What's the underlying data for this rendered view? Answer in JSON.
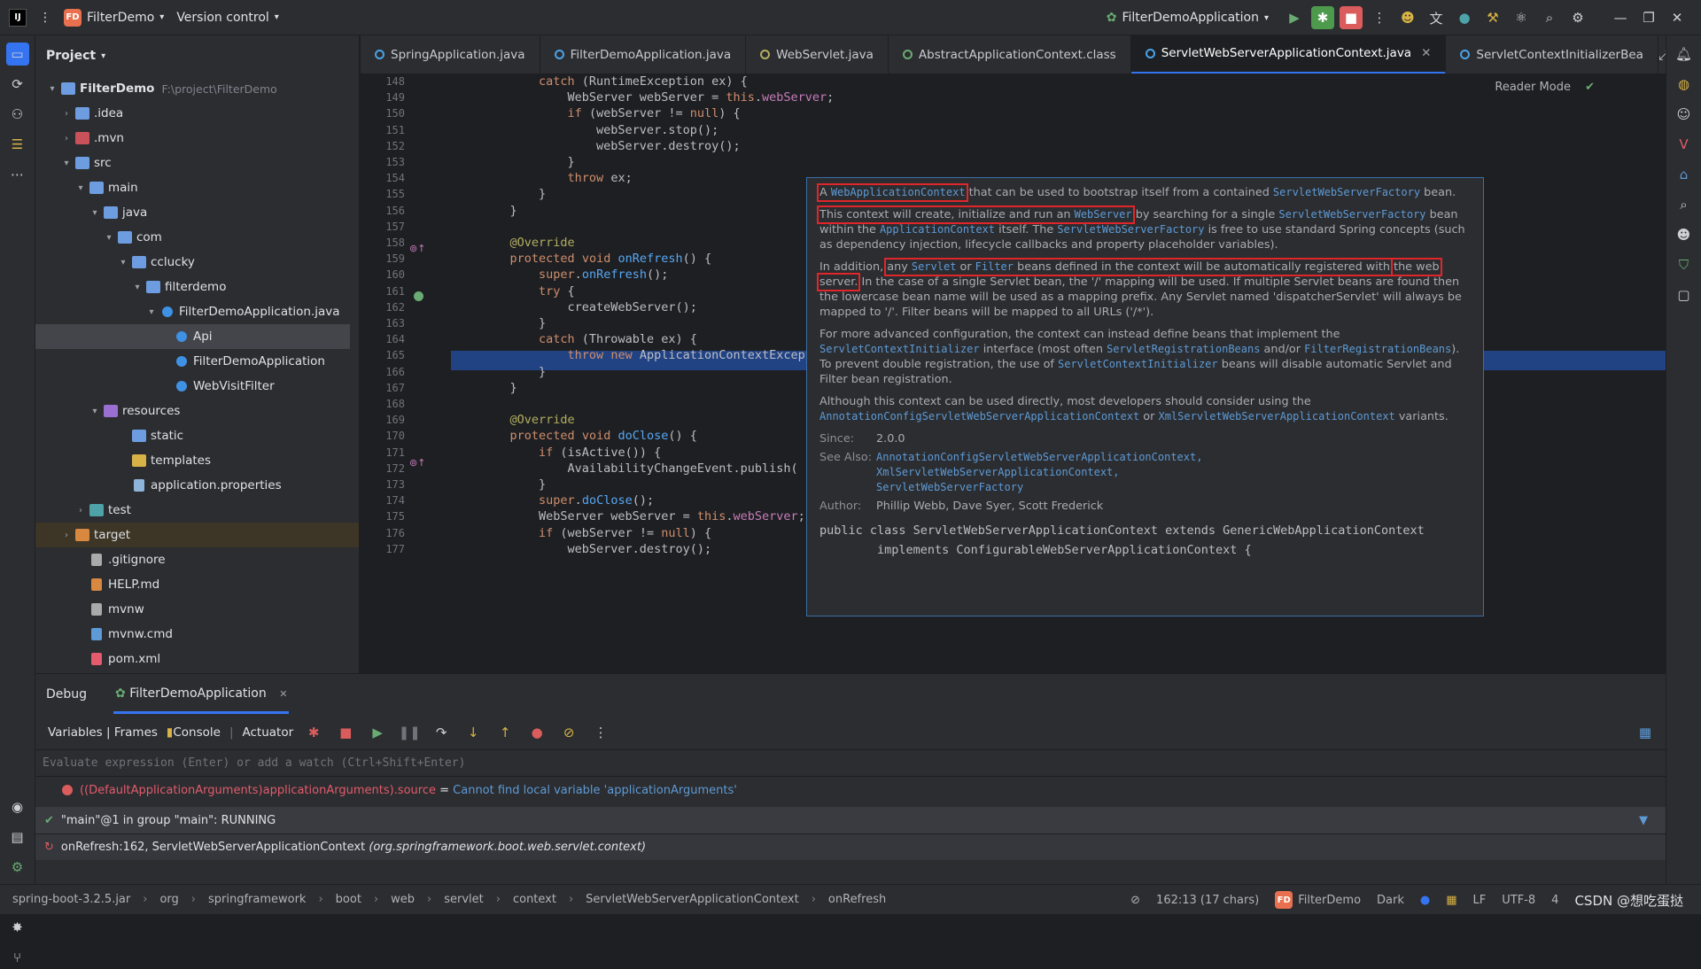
{
  "titlebar": {
    "project_badge": "FD",
    "project_name": "FilterDemo",
    "version_control": "Version control",
    "run_config": "FilterDemoApplication"
  },
  "project": {
    "title": "Project",
    "root": "FilterDemo",
    "root_path": "F:\\project\\FilterDemo",
    "items": [
      {
        "label": ".idea"
      },
      {
        "label": ".mvn"
      },
      {
        "label": "src"
      },
      {
        "label": "main"
      },
      {
        "label": "java"
      },
      {
        "label": "com"
      },
      {
        "label": "cclucky"
      },
      {
        "label": "filterdemo"
      },
      {
        "label": "FilterDemoApplication.java"
      },
      {
        "label": "Api"
      },
      {
        "label": "FilterDemoApplication"
      },
      {
        "label": "WebVisitFilter"
      },
      {
        "label": "resources"
      },
      {
        "label": "static"
      },
      {
        "label": "templates"
      },
      {
        "label": "application.properties"
      },
      {
        "label": "test"
      },
      {
        "label": "target"
      },
      {
        "label": ".gitignore"
      },
      {
        "label": "HELP.md"
      },
      {
        "label": "mvnw"
      },
      {
        "label": "mvnw.cmd"
      },
      {
        "label": "pom.xml"
      }
    ]
  },
  "tabs": [
    {
      "label": "SpringApplication.java"
    },
    {
      "label": "FilterDemoApplication.java"
    },
    {
      "label": "WebServlet.java"
    },
    {
      "label": "AbstractApplicationContext.class"
    },
    {
      "label": "ServletWebServerApplicationContext.java"
    },
    {
      "label": "ServletContextInitializerBea"
    }
  ],
  "editor": {
    "reader_mode": "Reader Mode",
    "lines": [
      {
        "n": "148",
        "t": "        catch (RuntimeException ex) {"
      },
      {
        "n": "149",
        "t": "            WebServer webServer = this.webServer;"
      },
      {
        "n": "150",
        "t": "            if (webServer != null) {"
      },
      {
        "n": "151",
        "t": "                webServer.stop();"
      },
      {
        "n": "152",
        "t": "                webServer.destroy();"
      },
      {
        "n": "153",
        "t": "            }"
      },
      {
        "n": "154",
        "t": "            throw ex;"
      },
      {
        "n": "155",
        "t": "        }"
      },
      {
        "n": "156",
        "t": "    }"
      },
      {
        "n": "157",
        "t": ""
      },
      {
        "n": "158",
        "t": "    @Override"
      },
      {
        "n": "159",
        "t": "    protected void onRefresh() {"
      },
      {
        "n": "160",
        "t": "        super.onRefresh();"
      },
      {
        "n": "161",
        "t": "        try {"
      },
      {
        "n": "162",
        "t": "            createWebServer();"
      },
      {
        "n": "163",
        "t": "        }"
      },
      {
        "n": "164",
        "t": "        catch (Throwable ex) {"
      },
      {
        "n": "165",
        "t": "            throw new ApplicationContextException("
      },
      {
        "n": "166",
        "t": "        }"
      },
      {
        "n": "167",
        "t": "    }"
      },
      {
        "n": "168",
        "t": ""
      },
      {
        "n": "169",
        "t": "    @Override"
      },
      {
        "n": "170",
        "t": "    protected void doClose() {"
      },
      {
        "n": "171",
        "t": "        if (isActive()) {"
      },
      {
        "n": "172",
        "t": "            AvailabilityChangeEvent.publish( contex"
      },
      {
        "n": "173",
        "t": "        }"
      },
      {
        "n": "174",
        "t": "        super.doClose();"
      },
      {
        "n": "175",
        "t": "        WebServer webServer = this.webServer;"
      },
      {
        "n": "176",
        "t": "        if (webServer != null) {"
      },
      {
        "n": "177",
        "t": "            webServer.destroy();"
      }
    ]
  },
  "doc": {
    "p1_a": "A ",
    "p1_link": "WebApplicationContext",
    "p1_b": " that can be used to bootstrap itself from a contained ",
    "p1_link2": "ServletWebServerFactory",
    "p1_c": " bean.",
    "p2_a": "This context will create, initialize and run an ",
    "p2_link": "WebServer",
    "p2_b": " by searching for a single ",
    "p2_link2": "ServletWebServerFactory",
    "p2_c": " bean within the ",
    "p2_link3": "ApplicationContext",
    "p2_d": " itself. The ",
    "p2_link4": "ServletWebServerFactory",
    "p2_e": " is free to use standard Spring concepts (such as dependency injection, lifecycle callbacks and property placeholder variables).",
    "p3_a": "In addition, ",
    "p3_b": "any ",
    "p3_link": "Servlet",
    "p3_c": " or ",
    "p3_link2": "Filter",
    "p3_d": " beans defined in the context will be automatically registered with",
    "p3_e": "the web server.",
    "p3_f": " In the case of a single Servlet bean, the '/' mapping will be used. If multiple Servlet beans are found then the lowercase bean name will be used as a mapping prefix. Any Servlet named 'dispatcherServlet' will always be mapped to '/'. Filter beans will be mapped to all URLs ('/*').",
    "p4_a": "For more advanced configuration, the context can instead define beans that implement the ",
    "p4_link": "ServletContextInitializer",
    "p4_b": " interface (most often ",
    "p4_link2": "ServletRegistrationBeans",
    "p4_c": " and/or ",
    "p4_link3": "FilterRegistrationBeans",
    "p4_d": "). To prevent double registration, the use of ",
    "p4_link4": "ServletContextInitializer",
    "p4_e": " beans will disable automatic Servlet and Filter bean registration.",
    "p5_a": "Although this context can be used directly, most developers should consider using the ",
    "p5_link": "AnnotationConfigServletWebServerApplicationContext",
    "p5_b": " or ",
    "p5_link2": "XmlServletWebServerApplicationContext",
    "p5_c": " variants.",
    "since_key": "Since:",
    "since_val": "2.0.0",
    "see_key": "See Also:",
    "see_1": "AnnotationConfigServletWebServerApplicationContext,",
    "see_2": "XmlServletWebServerApplicationContext,",
    "see_3": "ServletWebServerFactory",
    "author_key": "Author:",
    "author_val": "Phillip Webb, Dave Syer, Scott Frederick",
    "sig1": "public class ServletWebServerApplicationContext extends GenericWebApplicationContext",
    "sig2": "        implements ConfigurableWebServerApplicationContext {"
  },
  "debug": {
    "tab_debug": "Debug",
    "tab_session": "FilterDemoApplication",
    "toolbar_label": "Variables | Frames",
    "console": "Console",
    "actuator": "Actuator",
    "eval_placeholder": "Evaluate expression (Enter) or add a watch (Ctrl+Shift+Enter)",
    "var_expr": "((DefaultApplicationArguments)applicationArguments).source",
    "var_eq": " = ",
    "var_err": "Cannot find local variable 'applicationArguments'",
    "thread": "\"main\"@1 in group \"main\": RUNNING",
    "frame_a": "onRefresh:162, ServletWebServerApplicationContext ",
    "frame_b": "(org.springframework.boot.web.servlet.context)"
  },
  "statusbar": {
    "crumbs": [
      "spring-boot-3.2.5.jar",
      "org",
      "springframework",
      "boot",
      "web",
      "servlet",
      "context",
      "ServletWebServerApplicationContext",
      "onRefresh"
    ],
    "position": "162:13 (17 chars)",
    "project_badge": "FD",
    "project": "FilterDemo",
    "theme": "Dark",
    "line_sep": "LF",
    "encoding": "UTF-8",
    "indent": "4",
    "watermark": "CSDN @想吃蛋挞"
  }
}
